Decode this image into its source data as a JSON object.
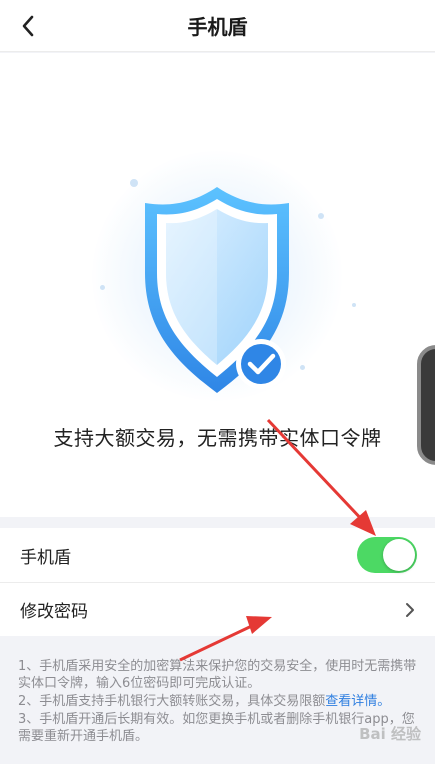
{
  "header": {
    "title": "手机盾"
  },
  "hero": {
    "slogan": "支持大额交易，无需携带实体口令牌"
  },
  "settings": {
    "rows": [
      {
        "label": "手机盾",
        "toggle_on": true
      },
      {
        "label": "修改密码"
      }
    ]
  },
  "notes": {
    "item1": "1、手机盾采用安全的加密算法来保护您的交易安全，使用时无需携带实体口令牌，输入6位密码即可完成认证。",
    "item2_text": "2、手机盾支持手机银行大额转账交易，具体交易限额",
    "item2_link": "查看详情。",
    "item3": "3、手机盾开通后长期有效。如您更换手机或者删除手机银行app，您需要重新开通手机盾。"
  },
  "watermark": "Bai 经验",
  "colors": {
    "toggle_on": "#4cd964",
    "link": "#2f7fe0",
    "shield_blue": "#3aa0f0",
    "annotation_red": "#e53935"
  },
  "icons": {
    "back": "chevron-left-icon",
    "row_arrow": "chevron-right-icon",
    "shield": "shield-check-icon"
  }
}
